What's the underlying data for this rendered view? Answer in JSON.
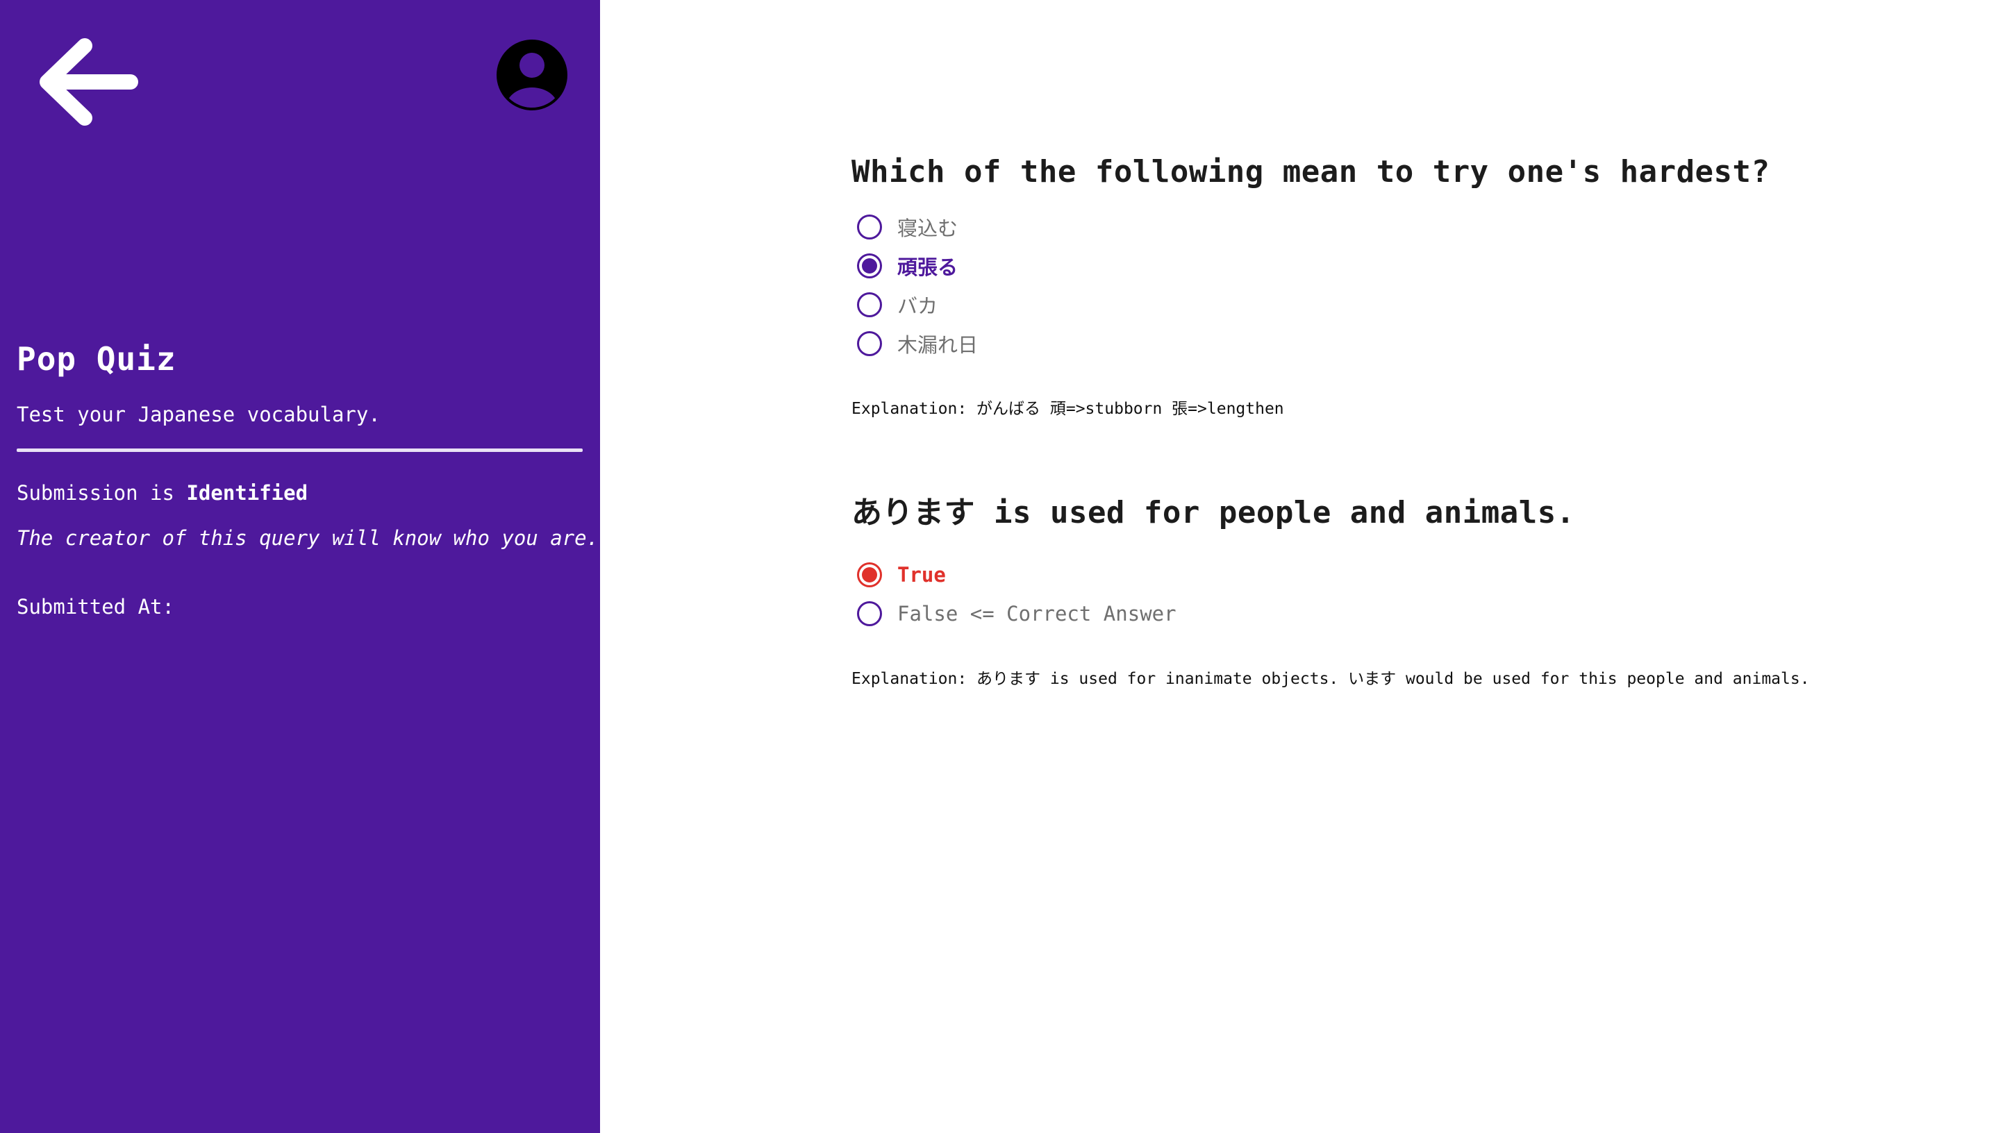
{
  "sidebar": {
    "back_icon": "arrow-left-icon",
    "avatar_icon": "user-avatar-icon",
    "title": "Pop Quiz",
    "description": "Test your Japanese vocabulary.",
    "submission_prefix": "Submission is ",
    "submission_status": "Identified",
    "identity_note": "The creator of this query will know who you are.",
    "submitted_at_label": "Submitted At:",
    "background_color": "#4e199c"
  },
  "questions": [
    {
      "text": "Which of the following mean to try one's hardest?",
      "options": [
        {
          "label": "寝込む",
          "state": "unselected"
        },
        {
          "label": "頑張る",
          "state": "selected"
        },
        {
          "label": "バカ",
          "state": "unselected"
        },
        {
          "label": "木漏れ日",
          "state": "unselected"
        }
      ],
      "explanation": "Explanation: がんばる 頑=>stubborn 張=>lengthen"
    },
    {
      "text": "あります is used for people and animals.",
      "options": [
        {
          "label": "True",
          "state": "wrong"
        },
        {
          "label": "False <= Correct Answer",
          "state": "unselected"
        }
      ],
      "explanation": "Explanation: あります is used for inanimate objects. います would be used for this people and animals."
    }
  ],
  "colors": {
    "accent": "#4e199c",
    "wrong": "#e0312b"
  }
}
